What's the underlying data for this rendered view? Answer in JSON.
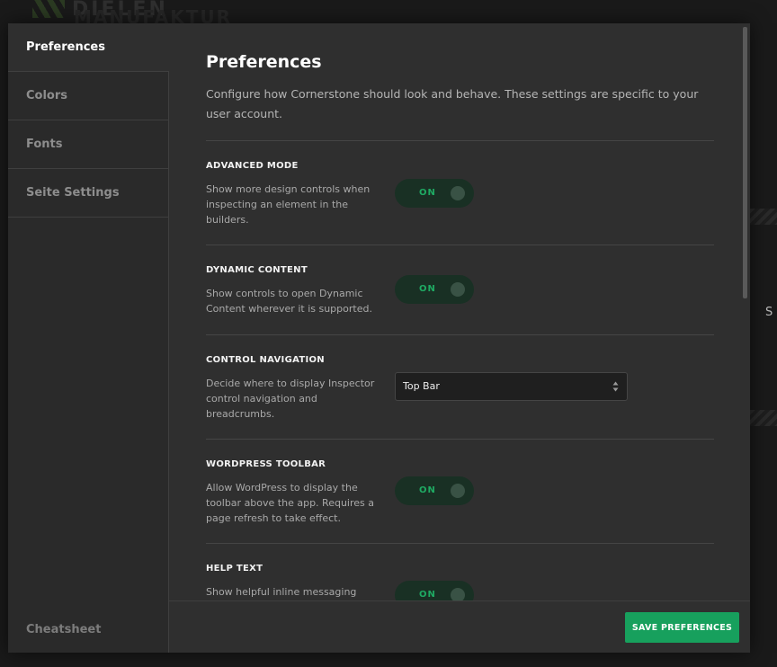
{
  "background": {
    "logo_line1": "DIELEN",
    "logo_line2": "MANUFAKTUR",
    "partial_char": "S"
  },
  "sidebar": {
    "items": [
      {
        "label": "Preferences",
        "active": true
      },
      {
        "label": "Colors",
        "active": false
      },
      {
        "label": "Fonts",
        "active": false
      },
      {
        "label": "Seite Settings",
        "active": false
      }
    ],
    "cheatsheet_label": "Cheatsheet"
  },
  "main": {
    "title": "Preferences",
    "description": "Configure how Cornerstone should look and behave. These settings are specific to your user account.",
    "settings": [
      {
        "title": "ADVANCED MODE",
        "description": "Show more design controls when inspecting an element in the builders.",
        "control": "toggle",
        "value": "ON"
      },
      {
        "title": "DYNAMIC CONTENT",
        "description": "Show controls to open Dynamic Content wherever it is supported.",
        "control": "toggle",
        "value": "ON"
      },
      {
        "title": "CONTROL NAVIGATION",
        "description": "Decide where to display Inspector control navigation and breadcrumbs.",
        "control": "select",
        "value": "Top Bar"
      },
      {
        "title": "WORDPRESS TOOLBAR",
        "description": "Allow WordPress to display the toolbar above the app. Requires a page refresh to take effect.",
        "control": "toggle",
        "value": "ON"
      },
      {
        "title": "HELP TEXT",
        "description": "Show helpful inline messaging",
        "control": "toggle",
        "value": "ON"
      }
    ]
  },
  "footer": {
    "save_label": "SAVE PREFERENCES"
  },
  "colors": {
    "accent": "#17a05d",
    "toggle_on_text": "#1faa63",
    "toggle_bg": "#193024"
  }
}
